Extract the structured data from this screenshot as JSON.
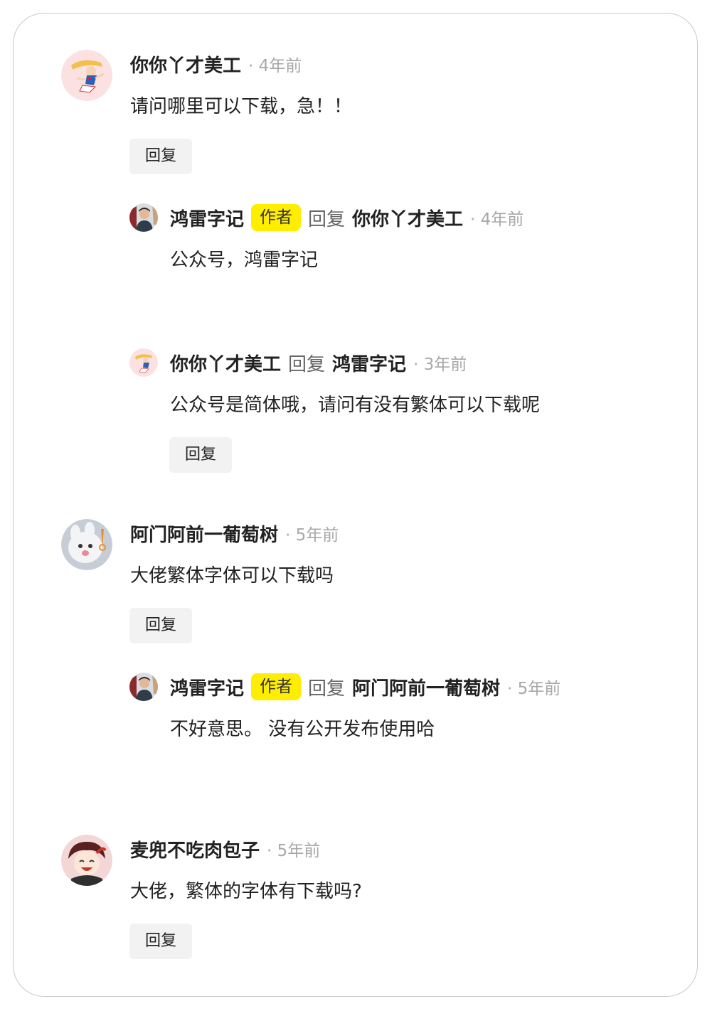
{
  "comments": [
    {
      "author": "你你丫才美工",
      "time": "· 4年前",
      "text": "请问哪里可以下载，急！！",
      "reply_button": "回复",
      "replies": [
        {
          "author": "鸿雷字记",
          "badge": "作者",
          "reply_word": "回复",
          "reply_to": "你你丫才美工",
          "time": "· 4年前",
          "text": "公众号，鸿雷字记"
        },
        {
          "author": "你你丫才美工",
          "reply_word": "回复",
          "reply_to": "鸿雷字记",
          "time": "· 3年前",
          "text": "公众号是简体哦，请问有没有繁体可以下载呢",
          "reply_button": "回复"
        }
      ]
    },
    {
      "author": "阿门阿前一葡萄树",
      "time": "· 5年前",
      "text": "大佬繁体字体可以下载吗",
      "reply_button": "回复",
      "replies": [
        {
          "author": "鸿雷字记",
          "badge": "作者",
          "reply_word": "回复",
          "reply_to": "阿门阿前一葡萄树",
          "time": "· 5年前",
          "text": "不好意思。 没有公开发布使用哈"
        }
      ]
    },
    {
      "author": "麦兜不吃肉包子",
      "time": "· 5年前",
      "text": "大佬，繁体的字体有下载吗?",
      "reply_button": "回复"
    }
  ],
  "colors": {
    "author_badge_bg": "#ffee00",
    "time_text": "#a8a8a8",
    "reply_button_bg": "#f2f2f2",
    "card_border": "#c8c8c8"
  }
}
